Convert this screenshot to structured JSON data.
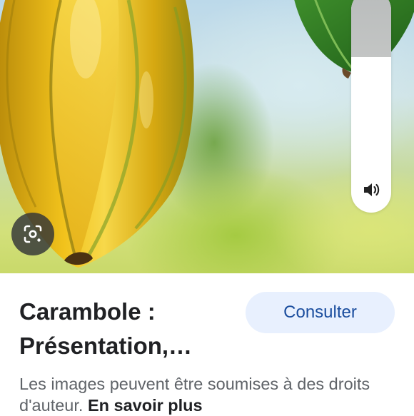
{
  "image_viewer": {
    "lens_icon": "google-lens-icon",
    "volume": {
      "level": 0.3,
      "icon": "speaker-icon"
    }
  },
  "result": {
    "title_line1": "Carambole :",
    "title_line2": "Présentation,…",
    "consult_label": "Consulter",
    "disclaimer_text": "Les images peuvent être soumises à des droits d'auteur.",
    "learn_more_label": "En savoir plus"
  },
  "colors": {
    "consult_bg": "#e8f0fe",
    "consult_text": "#1a4d9e",
    "title_text": "#202124",
    "disclaimer_text": "#5f6368"
  }
}
